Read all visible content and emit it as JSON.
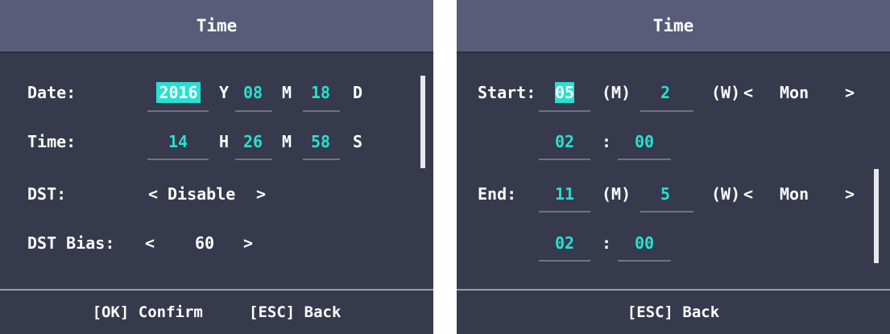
{
  "left": {
    "title": "Time",
    "date": {
      "label": "Date:",
      "year": "2016",
      "year_unit": "Y",
      "month": "08",
      "month_unit": "M",
      "day": "18",
      "day_unit": "D"
    },
    "time": {
      "label": "Time:",
      "hour": "14",
      "hour_unit": "H",
      "minute": "26",
      "minute_unit": "M",
      "second": "58",
      "second_unit": "S"
    },
    "dst": {
      "label": "DST:",
      "prev": "<",
      "value": "Disable",
      "next": ">"
    },
    "dst_bias": {
      "label": "DST Bias:",
      "prev": "<",
      "value": "60",
      "next": ">"
    },
    "footer": {
      "ok": "[OK] Confirm",
      "esc": "[ESC] Back"
    }
  },
  "right": {
    "title": "Time",
    "start": {
      "label": "Start:",
      "month": "05",
      "month_unit": "(M)",
      "week": "2",
      "week_unit": "(W)",
      "prev": "<",
      "day": "Mon",
      "next": ">",
      "hour": "02",
      "sep": ":",
      "minute": "00"
    },
    "end": {
      "label": "End:",
      "month": "11",
      "month_unit": "(M)",
      "week": "5",
      "week_unit": "(W)",
      "prev": "<",
      "day": "Mon",
      "next": ">",
      "hour": "02",
      "sep": ":",
      "minute": "00"
    },
    "footer": {
      "esc": "[ESC] Back"
    }
  },
  "colors": {
    "background": "#363a4c",
    "header": "#585c78",
    "accent": "#27e0d2",
    "text": "#ffffff"
  }
}
